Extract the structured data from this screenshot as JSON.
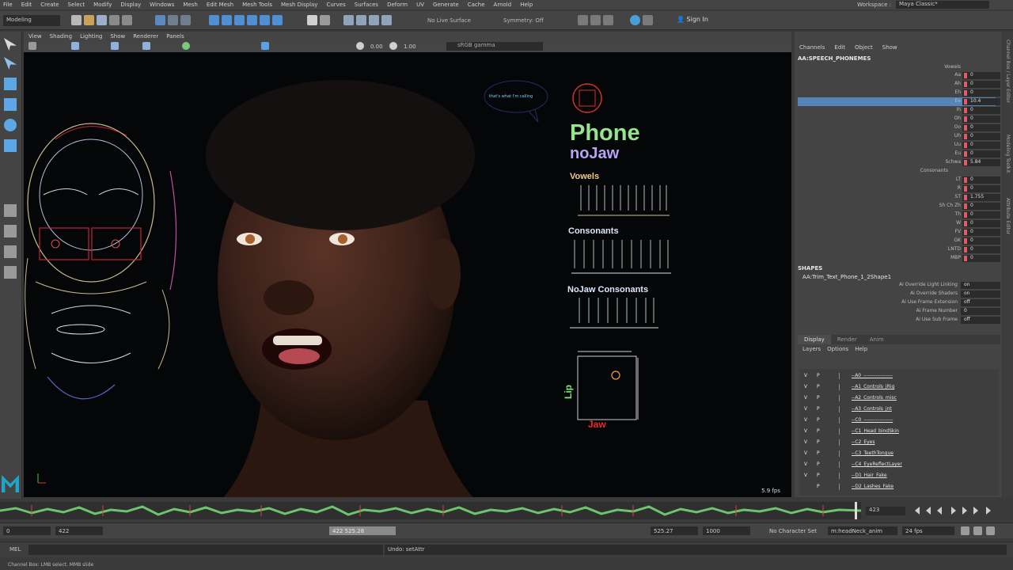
{
  "menubar": [
    "File",
    "Edit",
    "Create",
    "Select",
    "Modify",
    "Display",
    "Windows",
    "Mesh",
    "Edit Mesh",
    "Mesh Tools",
    "Mesh Display",
    "Curves",
    "Surfaces",
    "Deform",
    "UV",
    "Generate",
    "Cache",
    "Arnold",
    "Help"
  ],
  "workspace": {
    "label": "Workspace :",
    "value": "Maya Classic*"
  },
  "status_line": {
    "mode": "Modeling",
    "live_surface": "No Live Surface",
    "symmetry": "Symmetry: Off",
    "sign_in": "Sign In"
  },
  "viewport": {
    "menu": [
      "View",
      "Shading",
      "Lighting",
      "Show",
      "Renderer",
      "Panels"
    ],
    "toolbar": {
      "value_a": "0.00",
      "value_b": "1.00",
      "color_space": "sRGB gamma"
    },
    "fps": "5.9 fps"
  },
  "phone_panel": {
    "title": "Phone",
    "subtitle": "noJaw",
    "vowels": "Vowels",
    "consonants": "Consonants",
    "nojaw_consonants": "NoJaw Consonants",
    "lip": "Lip",
    "jaw": "Jaw",
    "bubble": "that's what I'm calling"
  },
  "channel_box": {
    "menu": [
      "Channels",
      "Edit",
      "Object",
      "Show"
    ],
    "node": "AA:SPEECH_PHONEMES",
    "attributes": [
      {
        "name": "Vowels",
        "value": ""
      },
      {
        "name": "Aa",
        "value": "0"
      },
      {
        "name": "Ah",
        "value": "0"
      },
      {
        "name": "Eh",
        "value": "0"
      },
      {
        "name": "Ee",
        "value": "10.4"
      },
      {
        "name": "Ih",
        "value": "0"
      },
      {
        "name": "Oh",
        "value": "0"
      },
      {
        "name": "Oo",
        "value": "0"
      },
      {
        "name": "Uh",
        "value": "0"
      },
      {
        "name": "Uu",
        "value": "0"
      },
      {
        "name": "Eu",
        "value": "0"
      },
      {
        "name": "Schwa",
        "value": "5.84"
      },
      {
        "name": "Consonants",
        "value": ""
      },
      {
        "name": "LT",
        "value": "0"
      },
      {
        "name": "R",
        "value": "0"
      },
      {
        "name": "ST",
        "value": "1.755"
      },
      {
        "name": "Sh Ch Zh",
        "value": "0"
      },
      {
        "name": "Th",
        "value": "0"
      },
      {
        "name": "W",
        "value": "0"
      },
      {
        "name": "FV",
        "value": "0"
      },
      {
        "name": "GK",
        "value": "0"
      },
      {
        "name": "LNTD",
        "value": "0"
      },
      {
        "name": "MBP",
        "value": "0"
      }
    ],
    "shapes_title": "SHAPES",
    "shapes_node": "AA:Trim_Text_Phone_1_2Shape1",
    "shape_attrs": [
      {
        "name": "Ai Override Light Linking",
        "value": "on"
      },
      {
        "name": "Ai Override Shaders",
        "value": "on"
      },
      {
        "name": "Ai Use Frame Extension",
        "value": "off"
      },
      {
        "name": "Ai Frame Number",
        "value": "0"
      },
      {
        "name": "Ai Use Sub Frame",
        "value": "off"
      }
    ]
  },
  "layer_editor": {
    "tabs": [
      "Display",
      "Render",
      "Anim"
    ],
    "menu": [
      "Layers",
      "Options",
      "Help"
    ],
    "layers": [
      {
        "v": "V",
        "p": "P",
        "name": "--A0_-----------------"
      },
      {
        "v": "V",
        "p": "P",
        "name": "--A1_Controls_jRig"
      },
      {
        "v": "V",
        "p": "P",
        "name": "--A2_Controls_misc"
      },
      {
        "v": "V",
        "p": "P",
        "name": "--A3_Controls_jnt"
      },
      {
        "v": "V",
        "p": "P",
        "name": "--C0_-----------------"
      },
      {
        "v": "V",
        "p": "P",
        "name": "--C1_Head_bindSkin"
      },
      {
        "v": "V",
        "p": "P",
        "name": "--C2_Eyes"
      },
      {
        "v": "V",
        "p": "P",
        "name": "--C3_TeethTongue"
      },
      {
        "v": "V",
        "p": "P",
        "name": "--C4_EyeReflectLayer"
      },
      {
        "v": "V",
        "p": "P",
        "name": "--D1_Hair_Fake"
      },
      {
        "v": "",
        "p": "P",
        "name": "--D2_Lashes_Fake"
      }
    ]
  },
  "side_tabs": [
    "Channel Box / Layer Editor",
    "Modeling Toolkit",
    "Attribute Editor"
  ],
  "timeline": {
    "end_frame": "423"
  },
  "range_slider": {
    "start": "0",
    "current": "422",
    "range_start": "422",
    "range_end": "525.28",
    "anim_end": "525.27",
    "max": "1000",
    "character_set": "No Character Set",
    "anim_layer": "m:headNeck_anim",
    "fps": "24 fps"
  },
  "command_line": {
    "lang": "MEL",
    "result": "Undo: setAttr"
  },
  "help_line": "Channel Box: LMB select. MMB slide"
}
